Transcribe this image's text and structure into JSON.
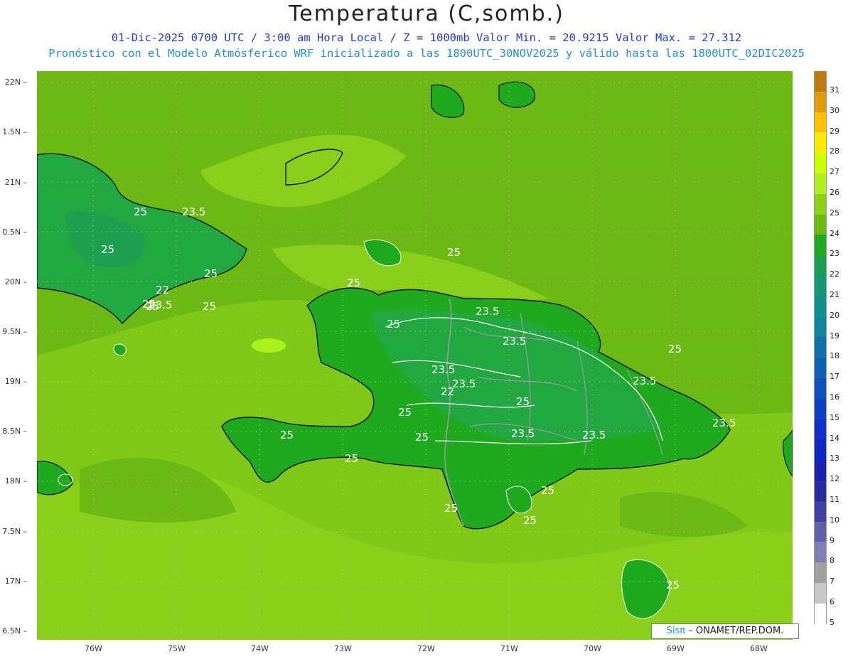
{
  "header": {
    "title": "Temperatura (C,somb.)",
    "subtitle1": "01-Dic-2025  0700 UTC / 3:00 am Hora Local / Z = 1000mb    Valor Min. = 20.9215  Valor Max. = 27.312",
    "subtitle2": "Pronóstico con el Modelo Atmósferico WRF inicializado a las 1800UTC_30NOV2025 y válido hasta las  1800UTC_02DIC2025"
  },
  "map": {
    "lat_labels": [
      "22N",
      "1.5N",
      "21N",
      "0.5N",
      "20N",
      "9.5N",
      "19N",
      "8.5N",
      "18N",
      "7.5N",
      "17N",
      "6.5N"
    ],
    "lon_labels": [
      "76W",
      "75W",
      "74W",
      "73W",
      "72W",
      "71W",
      "70W",
      "69W",
      "68W"
    ],
    "contour_labels": [
      "25",
      "23.5",
      "25",
      "22",
      "25",
      "23.5",
      "25",
      "25",
      "25",
      "23.5",
      "25",
      "23.5",
      "23.5",
      "25",
      "23.5",
      "22",
      "23.5",
      "25",
      "25",
      "23.5",
      "25",
      "23.5",
      "25",
      "23.5",
      "25",
      "25",
      "25",
      "25",
      "25",
      "25",
      "25"
    ],
    "colors": {
      "c24": "#1ea91e",
      "c23": "#22a840",
      "c25": "#6cb814",
      "c26": "#8fd21a",
      "c27": "#aaf01a",
      "coast": "#111111",
      "border": "#9a9a9a"
    }
  },
  "colorbar": {
    "labels": [
      "31",
      "30",
      "29",
      "28",
      "27",
      "26",
      "25",
      "24",
      "23",
      "22",
      "21",
      "20",
      "19",
      "18",
      "17",
      "16",
      "15",
      "14",
      "13",
      "12",
      "11",
      "10",
      "9",
      "8",
      "7",
      "6",
      "5"
    ],
    "colors": [
      "#c07a10",
      "#e09a10",
      "#ffc000",
      "#ffea00",
      "#ccff00",
      "#b0ee20",
      "#8ed01c",
      "#6cb814",
      "#1faa1f",
      "#1aa050",
      "#169878",
      "#12908e",
      "#10869e",
      "#1070aa",
      "#1060b4",
      "#1050bc",
      "#1040c4",
      "#1030cc",
      "#1028c0",
      "#1a22b0",
      "#2a2aa0",
      "#4040a0",
      "#6060a8",
      "#8080b0",
      "#a0a0a0",
      "#c8c8c8",
      "#ffffff"
    ]
  },
  "credit": {
    "logo": "Sisπ",
    "text": "– ONAMET/REP.DOM."
  }
}
